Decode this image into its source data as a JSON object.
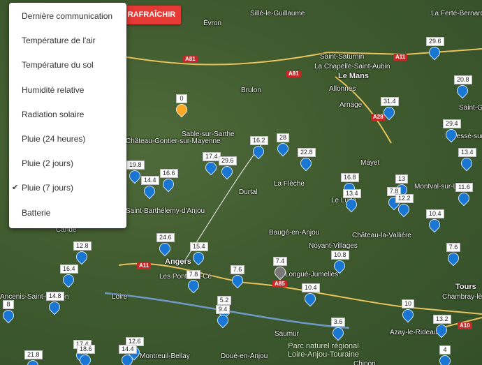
{
  "colors": {
    "accent": "#e53935",
    "marker_blue": "#1976d2",
    "marker_grey": "#777777",
    "marker_yellow": "#f9a825"
  },
  "refresh_button": {
    "label": "RAFRAÎCHIR"
  },
  "menu": {
    "items": [
      {
        "label": "Dernière communication",
        "checked": false
      },
      {
        "label": "Température de l'air",
        "checked": false
      },
      {
        "label": "Température du sol",
        "checked": false
      },
      {
        "label": "Humidité relative",
        "checked": false
      },
      {
        "label": "Radiation solaire",
        "checked": false
      },
      {
        "label": "Pluie (24 heures)",
        "checked": false
      },
      {
        "label": "Pluie (2 jours)",
        "checked": false
      },
      {
        "label": "Pluie (7 jours)",
        "checked": true
      },
      {
        "label": "Batterie",
        "checked": false
      }
    ],
    "check_icon": "✔"
  },
  "places": [
    "Sillé-le-Guillaume",
    "Évron",
    "La Ferté-Bernard",
    "Saint-Saturnin",
    "La Chapelle-Saint-Aubin",
    "Le Mans",
    "Allonnes",
    "Arnage",
    "Brulon",
    "Sable-sur-Sarthe",
    "Château-Gontier-sur-Mayenne",
    "Durtal",
    "La Flèche",
    "Mayet",
    "Le Lude",
    "Château-la-Vallière",
    "Baugé-en-Anjou",
    "Noyant-Villages",
    "Candé",
    "Angers",
    "Les Ponts-de-Cé",
    "Longué-Jumelles",
    "Tours",
    "Chambray-lès-Tours",
    "Azay-le-Rideau",
    "Saumur",
    "Doué-en-Anjou",
    "Ancenis-Saint-Géréon",
    "Loire",
    "Montval-sur-Loir",
    "Saint-Gervais",
    "Bessé-sur-Braye",
    "Saint-Barthélemy-d'Anjou",
    "Chinon",
    "Montreuil-Bellay"
  ],
  "park": "Parc naturel régional Loire-Anjou-Touraine",
  "roads": [
    "A81",
    "A11",
    "A81",
    "A28",
    "A85",
    "A11",
    "A10"
  ],
  "stations": [
    {
      "value": "29.6",
      "color": "blue"
    },
    {
      "value": "20.8",
      "color": "blue"
    },
    {
      "value": "0",
      "color": "yellow"
    },
    {
      "value": "31.4",
      "color": "blue"
    },
    {
      "value": "29.4",
      "color": "blue"
    },
    {
      "value": "13.4",
      "color": "blue"
    },
    {
      "value": "16.2",
      "color": "blue"
    },
    {
      "value": "28",
      "color": "blue"
    },
    {
      "value": "22.8",
      "color": "blue"
    },
    {
      "value": "17.4",
      "color": "blue"
    },
    {
      "value": "29.6",
      "color": "blue"
    },
    {
      "value": "19.8",
      "color": "blue"
    },
    {
      "value": "16.6",
      "color": "blue"
    },
    {
      "value": "14.4",
      "color": "blue"
    },
    {
      "value": "16.8",
      "color": "blue"
    },
    {
      "value": "13.4",
      "color": "blue"
    },
    {
      "value": "13",
      "color": "blue"
    },
    {
      "value": "7.8",
      "color": "blue"
    },
    {
      "value": "12.2",
      "color": "blue"
    },
    {
      "value": "11.6",
      "color": "blue"
    },
    {
      "value": "10.4",
      "color": "blue"
    },
    {
      "value": "24.6",
      "color": "blue"
    },
    {
      "value": "15.4",
      "color": "blue"
    },
    {
      "value": "12.8",
      "color": "blue"
    },
    {
      "value": "16.4",
      "color": "blue"
    },
    {
      "value": "7.8",
      "color": "blue"
    },
    {
      "value": "7.6",
      "color": "blue"
    },
    {
      "value": "7.4",
      "color": "grey"
    },
    {
      "value": "10.8",
      "color": "blue"
    },
    {
      "value": "7.6",
      "color": "blue"
    },
    {
      "value": "14.8",
      "color": "blue"
    },
    {
      "value": "5.2",
      "color": "blue"
    },
    {
      "value": "9.4",
      "color": "blue"
    },
    {
      "value": "10.4",
      "color": "blue"
    },
    {
      "value": "3.6",
      "color": "blue"
    },
    {
      "value": "10",
      "color": "blue"
    },
    {
      "value": "13.2",
      "color": "blue"
    },
    {
      "value": "17.4",
      "color": "blue"
    },
    {
      "value": "18.6",
      "color": "blue"
    },
    {
      "value": "12.6",
      "color": "blue"
    },
    {
      "value": "14.4",
      "color": "blue"
    },
    {
      "value": "21.8",
      "color": "blue"
    },
    {
      "value": "4",
      "color": "blue"
    },
    {
      "value": "8",
      "color": "blue"
    }
  ]
}
